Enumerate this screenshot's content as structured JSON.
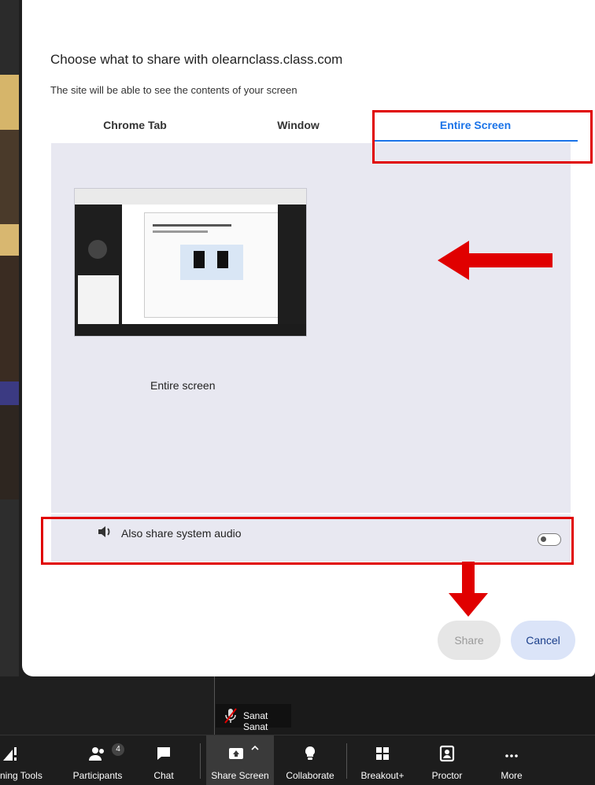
{
  "dialog": {
    "title": "Choose what to share with olearnclass.class.com",
    "subtitle": "The site will be able to see the contents of your screen",
    "tabs": [
      {
        "label": "Chrome Tab",
        "selected": false
      },
      {
        "label": "Window",
        "selected": false
      },
      {
        "label": "Entire Screen",
        "selected": true
      }
    ],
    "preview_label": "Entire screen",
    "audio_label": "Also share system audio",
    "audio_toggle_on": false,
    "share_label": "Share",
    "cancel_label": "Cancel"
  },
  "participant": {
    "name": "Sanat Sanat",
    "icon": "mic-muted-icon"
  },
  "toolbar": {
    "items": [
      {
        "label": "ning Tools",
        "icon": "polling-tools-icon"
      },
      {
        "label": "Participants",
        "icon": "participants-icon",
        "badge": "4"
      },
      {
        "label": "Chat",
        "icon": "chat-icon"
      },
      {
        "label": "Share Screen",
        "icon": "share-screen-icon"
      },
      {
        "label": "Collaborate",
        "icon": "lightbulb-icon"
      },
      {
        "label": "Breakout+",
        "icon": "breakout-icon"
      },
      {
        "label": "Proctor",
        "icon": "proctor-icon"
      },
      {
        "label": "More",
        "icon": "more-icon"
      }
    ]
  },
  "colors": {
    "accent": "#1a73e8",
    "highlight": "#e00000",
    "content_bg": "#e8e8f1"
  }
}
